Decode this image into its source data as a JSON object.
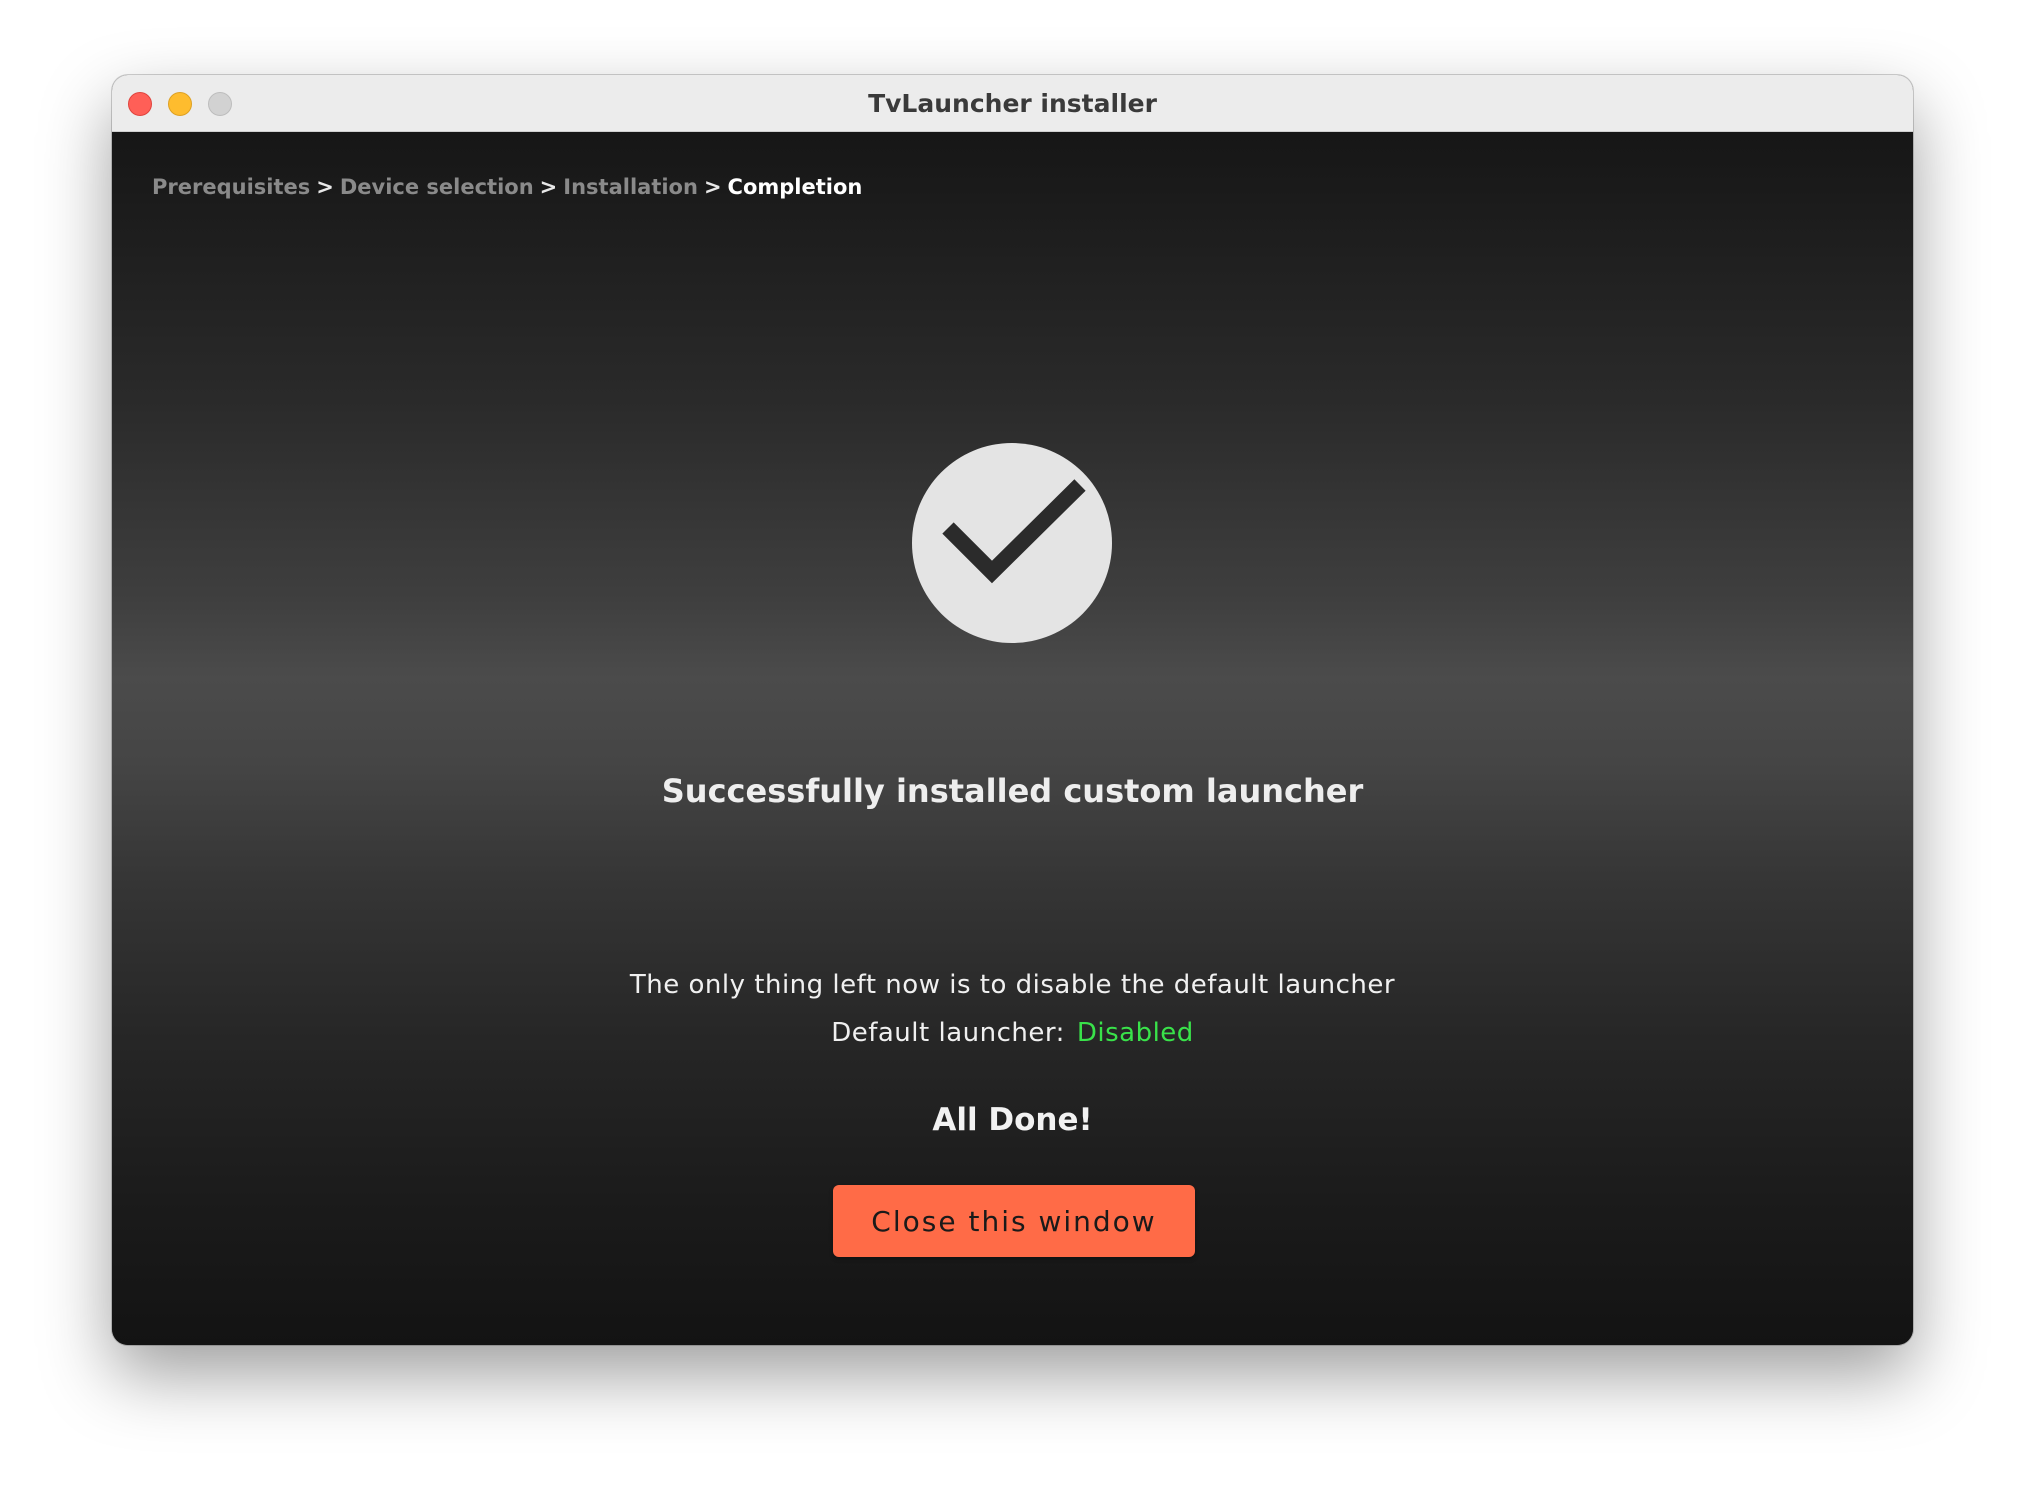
{
  "window": {
    "title": "TvLauncher installer"
  },
  "breadcrumb": {
    "steps": [
      "Prerequisites",
      "Device selection",
      "Installation",
      "Completion"
    ],
    "separator": ">",
    "current_index": 3
  },
  "main": {
    "icon": "checkmark-circle-icon",
    "headline": "Successfully installed custom launcher",
    "info_text": "The only thing left now is to disable the default launcher",
    "status_label": "Default launcher:",
    "status_value": "Disabled",
    "done_text": "All Done!",
    "close_button_label": "Close this window"
  },
  "colors": {
    "accent_button": "#ff6b47",
    "status_ok": "#39e24a",
    "traffic_close": "#ff5f57",
    "traffic_minimize": "#febc2e",
    "traffic_zoom_inactive": "#d2d2d2"
  }
}
